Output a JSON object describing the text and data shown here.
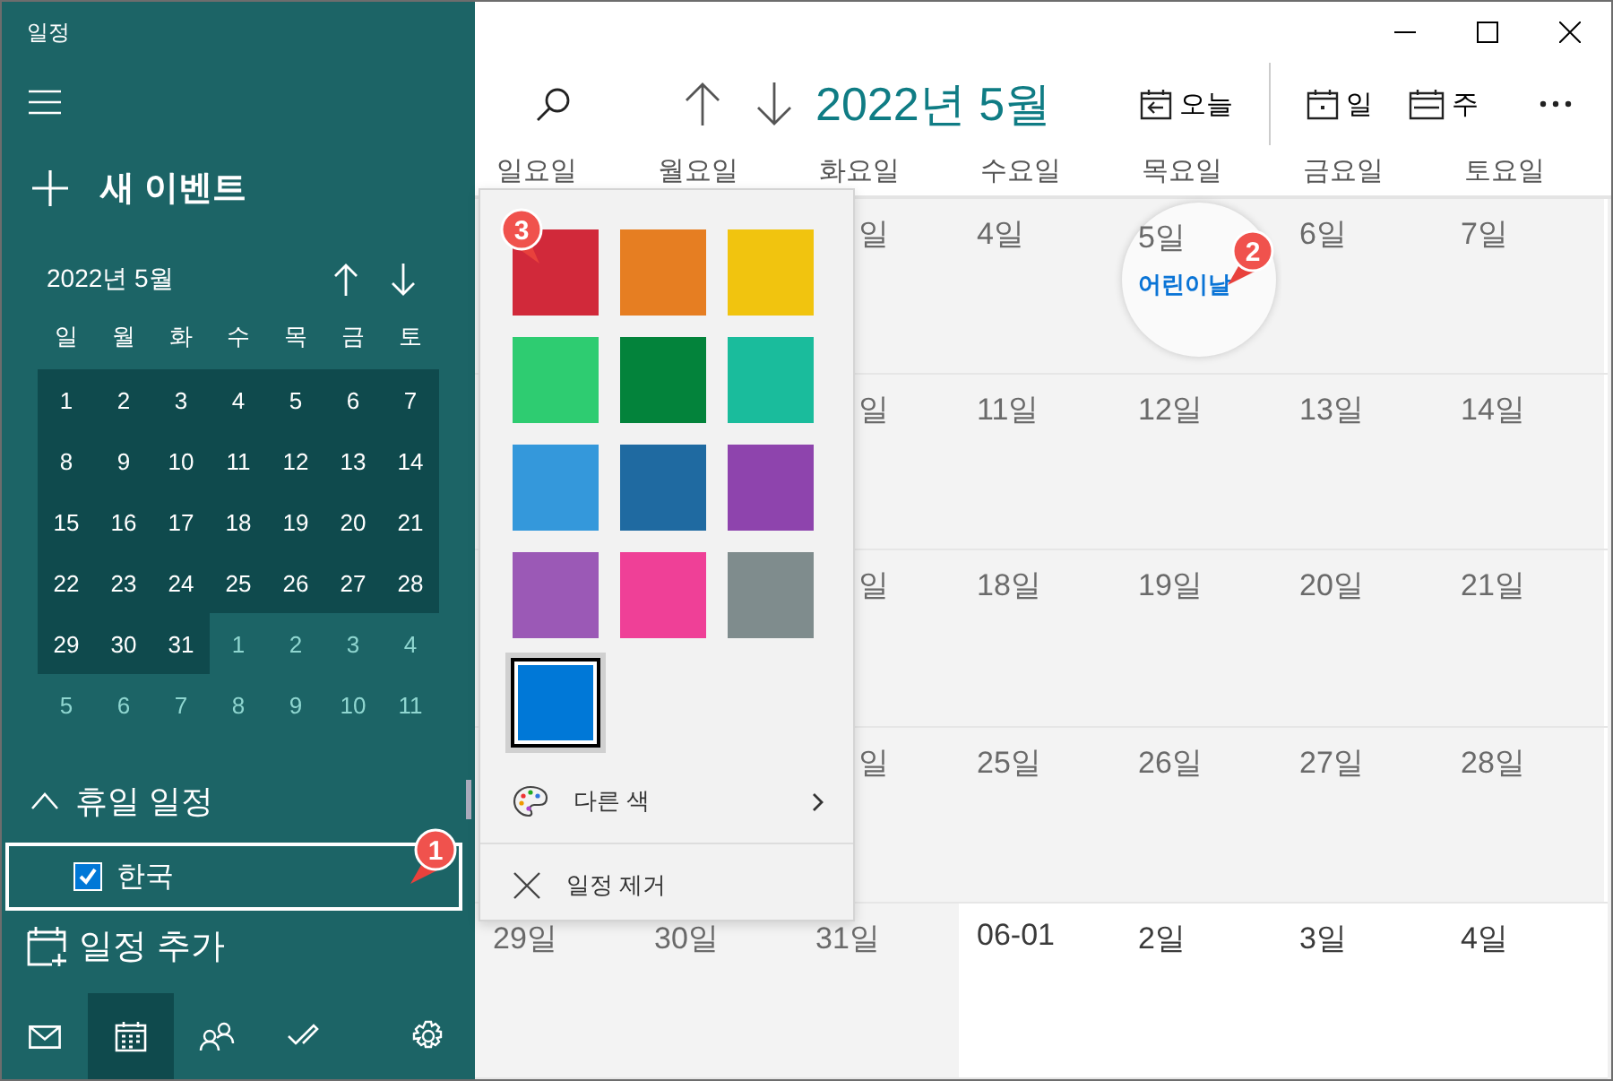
{
  "window": {
    "title": "일정"
  },
  "sidebar": {
    "new_event": "새 이벤트",
    "mini_calendar": {
      "title": "2022년 5월",
      "weekdays": [
        "일",
        "월",
        "화",
        "수",
        "목",
        "금",
        "토"
      ],
      "days": [
        {
          "label": "1",
          "in_month": true
        },
        {
          "label": "2",
          "in_month": true
        },
        {
          "label": "3",
          "in_month": true
        },
        {
          "label": "4",
          "in_month": true
        },
        {
          "label": "5",
          "in_month": true
        },
        {
          "label": "6",
          "in_month": true
        },
        {
          "label": "7",
          "in_month": true
        },
        {
          "label": "8",
          "in_month": true
        },
        {
          "label": "9",
          "in_month": true
        },
        {
          "label": "10",
          "in_month": true
        },
        {
          "label": "11",
          "in_month": true
        },
        {
          "label": "12",
          "in_month": true
        },
        {
          "label": "13",
          "in_month": true
        },
        {
          "label": "14",
          "in_month": true
        },
        {
          "label": "15",
          "in_month": true
        },
        {
          "label": "16",
          "in_month": true
        },
        {
          "label": "17",
          "in_month": true
        },
        {
          "label": "18",
          "in_month": true
        },
        {
          "label": "19",
          "in_month": true
        },
        {
          "label": "20",
          "in_month": true
        },
        {
          "label": "21",
          "in_month": true
        },
        {
          "label": "22",
          "in_month": true
        },
        {
          "label": "23",
          "in_month": true
        },
        {
          "label": "24",
          "in_month": true
        },
        {
          "label": "25",
          "in_month": true
        },
        {
          "label": "26",
          "in_month": true
        },
        {
          "label": "27",
          "in_month": true
        },
        {
          "label": "28",
          "in_month": true
        },
        {
          "label": "29",
          "in_month": true
        },
        {
          "label": "30",
          "in_month": true
        },
        {
          "label": "31",
          "in_month": true
        },
        {
          "label": "1",
          "in_month": false
        },
        {
          "label": "2",
          "in_month": false
        },
        {
          "label": "3",
          "in_month": false
        },
        {
          "label": "4",
          "in_month": false
        },
        {
          "label": "5",
          "in_month": false
        },
        {
          "label": "6",
          "in_month": false
        },
        {
          "label": "7",
          "in_month": false
        },
        {
          "label": "8",
          "in_month": false
        },
        {
          "label": "9",
          "in_month": false
        },
        {
          "label": "10",
          "in_month": false
        },
        {
          "label": "11",
          "in_month": false
        }
      ]
    },
    "calendar_group": {
      "label": "휴일 일정",
      "expanded": true,
      "calendars": [
        {
          "label": "한국",
          "checked": true,
          "selected": true
        }
      ]
    },
    "add_calendar": "일정 추가",
    "nav": [
      {
        "kind": "mail",
        "selected": false
      },
      {
        "kind": "calendar",
        "selected": true
      },
      {
        "kind": "people",
        "selected": false
      },
      {
        "kind": "todo",
        "selected": false
      },
      {
        "kind": "settings",
        "selected": false
      }
    ]
  },
  "toolbar": {
    "month_title": "2022년 5월",
    "buttons": [
      {
        "kind": "today",
        "label": "오늘"
      },
      {
        "kind": "day",
        "label": "일"
      },
      {
        "kind": "week",
        "label": "주"
      }
    ]
  },
  "month_grid": {
    "weekdays": [
      "일요일",
      "월요일",
      "화요일",
      "수요일",
      "목요일",
      "금요일",
      "토요일"
    ],
    "weeks": [
      {
        "cells": [
          {},
          {},
          {
            "in_month": true,
            "label": "일"
          },
          {
            "in_month": true,
            "label": "4일"
          },
          {
            "in_month": true,
            "label": "5일",
            "magnified": true,
            "events": [
              {
                "title": "어린이날"
              }
            ]
          },
          {
            "in_month": true,
            "label": "6일"
          },
          {
            "in_month": true,
            "label": "7일"
          }
        ]
      },
      {
        "cells": [
          {},
          {},
          {
            "in_month": true,
            "label": "일"
          },
          {
            "in_month": true,
            "label": "11일"
          },
          {
            "in_month": true,
            "label": "12일"
          },
          {
            "in_month": true,
            "label": "13일"
          },
          {
            "in_month": true,
            "label": "14일"
          }
        ]
      },
      {
        "cells": [
          {},
          {},
          {
            "in_month": true,
            "label": "일"
          },
          {
            "in_month": true,
            "label": "18일"
          },
          {
            "in_month": true,
            "label": "19일"
          },
          {
            "in_month": true,
            "label": "20일"
          },
          {
            "in_month": true,
            "label": "21일"
          }
        ]
      },
      {
        "cells": [
          {},
          {},
          {
            "in_month": true,
            "label": "일"
          },
          {
            "in_month": true,
            "label": "25일"
          },
          {
            "in_month": true,
            "label": "26일"
          },
          {
            "in_month": true,
            "label": "27일"
          },
          {
            "in_month": true,
            "label": "28일"
          }
        ]
      },
      {
        "cells": [
          {
            "in_month": true,
            "label": "29일"
          },
          {
            "in_month": true,
            "label": "30일"
          },
          {
            "in_month": true,
            "label": "31일"
          },
          {
            "in_month": false,
            "label": "06-01"
          },
          {
            "in_month": false,
            "label": "2일"
          },
          {
            "in_month": false,
            "label": "3일"
          },
          {
            "in_month": false,
            "label": "4일"
          }
        ]
      }
    ]
  },
  "color_menu": {
    "swatches": [
      {
        "color": "#d1293a",
        "selected": false
      },
      {
        "color": "#e67e22",
        "selected": false
      },
      {
        "color": "#f1c40f",
        "selected": false
      },
      {
        "color": "#2ecc71",
        "selected": false
      },
      {
        "color": "#03833b",
        "selected": false
      },
      {
        "color": "#1abc9c",
        "selected": false
      },
      {
        "color": "#3498db",
        "selected": false
      },
      {
        "color": "#1f6aa1",
        "selected": false
      },
      {
        "color": "#8e44ad",
        "selected": false
      },
      {
        "color": "#9b59b6",
        "selected": false
      },
      {
        "color": "#ef4097",
        "selected": false
      },
      {
        "color": "#7f8c8d",
        "selected": false
      },
      {
        "color": "#0078d7",
        "selected": true
      }
    ],
    "items": [
      {
        "kind": "palette",
        "label": "다른 색"
      },
      {
        "kind": "remove",
        "label": "일정 제거"
      }
    ]
  },
  "callouts": [
    {
      "label": "1"
    },
    {
      "label": "2"
    },
    {
      "label": "3"
    }
  ]
}
